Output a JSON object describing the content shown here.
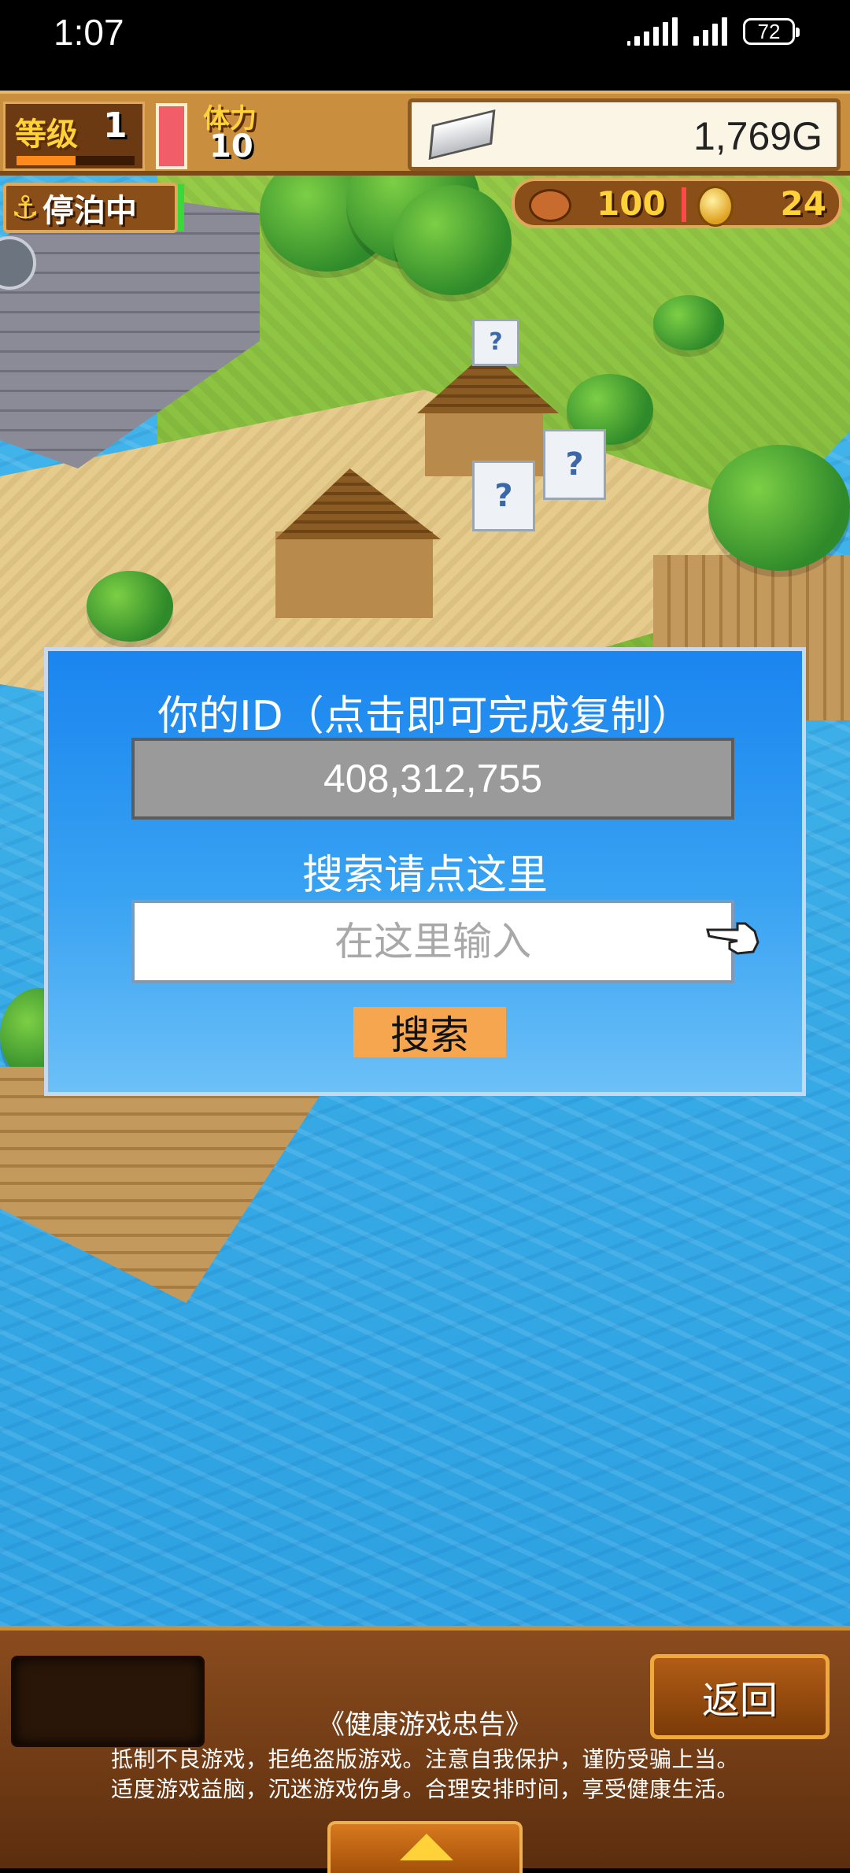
{
  "status_bar": {
    "time": "1:07",
    "battery": "72"
  },
  "hud": {
    "level_label": "等级",
    "level_value": "1",
    "level_progress": 0.5,
    "stamina_label": "体力",
    "stamina_value": "10",
    "gold": "1,769G",
    "dock_status": "停泊中",
    "food": "100",
    "coins": "24"
  },
  "dialog": {
    "title": "你的ID（点击即可完成复制）",
    "user_id": "408,312,755",
    "search_hint": "搜索请点这里",
    "input_placeholder": "在这里输入",
    "input_value": "",
    "search_button": "搜索"
  },
  "bottom": {
    "back_button": "返回",
    "notice_title": "《健康游戏忠告》",
    "notice_line1": "抵制不良游戏，拒绝盗版游戏。注意自我保护，谨防受骗上当。",
    "notice_line2": "适度游戏益脑，沉迷游戏伤身。合理安排时间，享受健康生活。"
  },
  "colors": {
    "dialog_blue": "#1a85ef",
    "search_button": "#f5a64e",
    "hud_gold_text": "#ffd23a",
    "panel_brown": "#8a4e18"
  }
}
